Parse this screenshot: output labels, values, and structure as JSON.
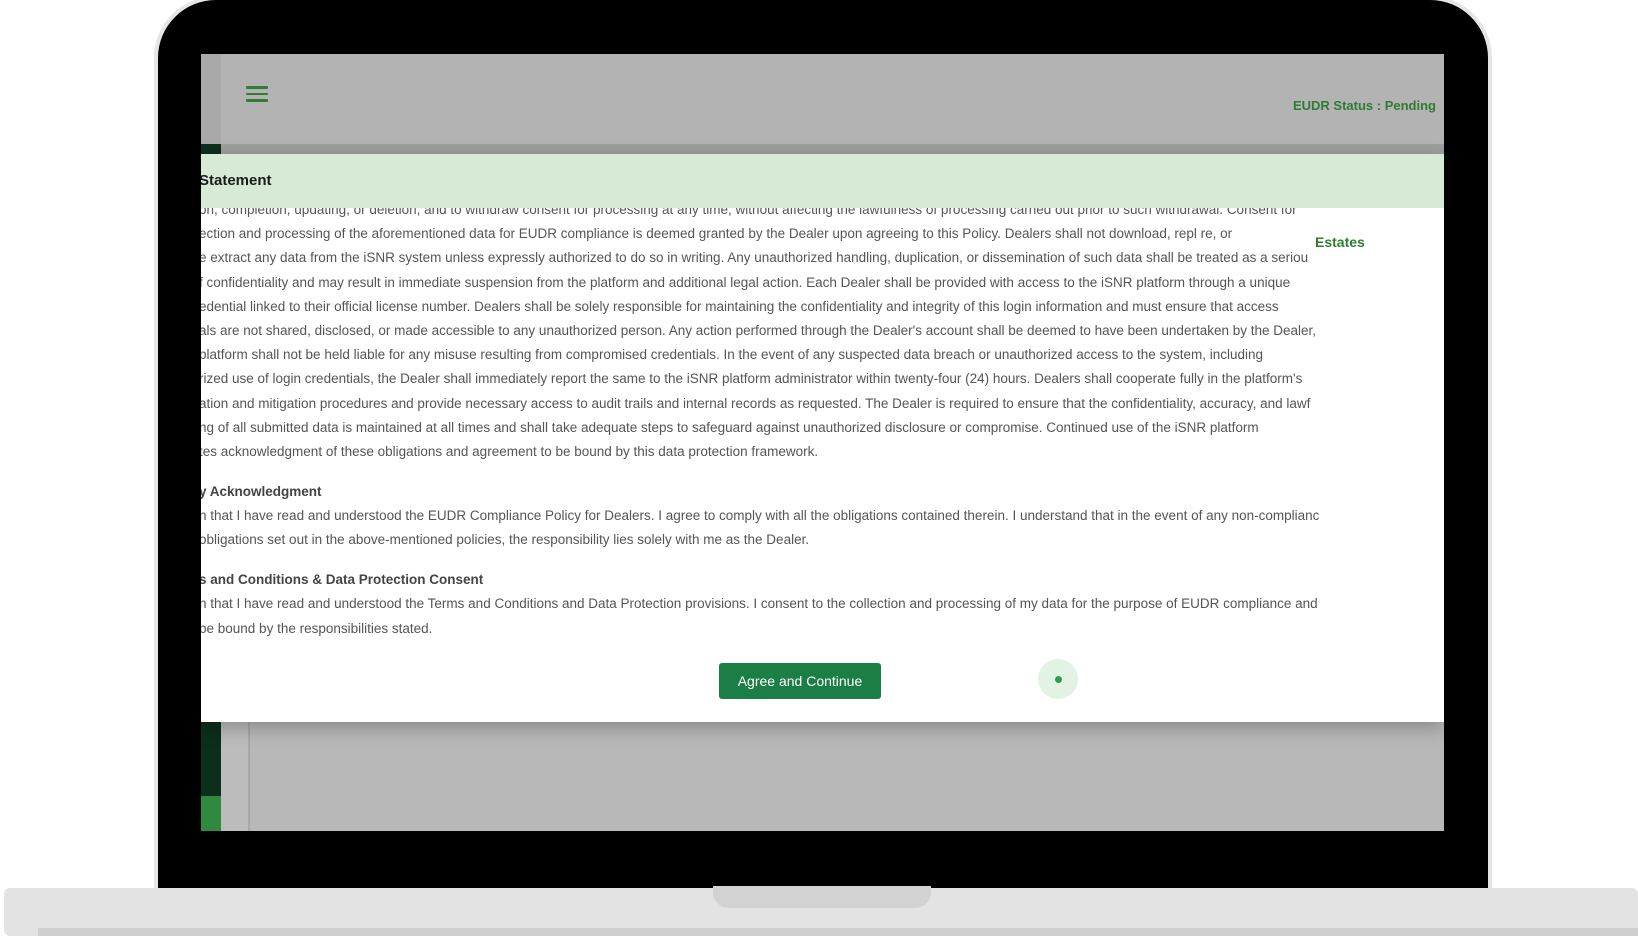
{
  "header": {
    "status_text": "EUDR Status : Pending"
  },
  "modal": {
    "title": "Statement",
    "estates_tag": "Estates",
    "paragraph_lines": [
      "on, completion, updating, or deletion, and to withdraw consent for processing at any time, without affecting the lawfulness of processing carried out prior to such withdrawal. Consent for",
      "ection and processing of the aforementioned data for EUDR compliance is deemed granted by the Dealer upon agreeing to this Policy. Dealers shall not download, repl                     re, or",
      "e extract any data from the iSNR system unless expressly authorized to do so in writing. Any unauthorized handling, duplication, or dissemination of such data shall be treated as a seriou",
      "f confidentiality and may result in immediate suspension from the platform and additional legal action. Each Dealer shall be provided with access to the iSNR platform through a unique",
      "edential linked to their official license number. Dealers shall be solely responsible for maintaining the confidentiality and integrity of this login information and must ensure that access",
      "als are not shared, disclosed, or made accessible to any unauthorized person. Any action performed through the Dealer's account shall be deemed to have been undertaken by the Dealer,",
      "platform shall not be held liable for any misuse resulting from compromised credentials. In the event of any suspected data breach or unauthorized access to the system, including",
      "rized use of login credentials, the Dealer shall immediately report the same to the iSNR platform administrator within twenty-four (24) hours. Dealers shall cooperate fully in the platform's",
      "ation and mitigation procedures and provide necessary access to audit trails and internal records as requested. The Dealer is required to ensure that the confidentiality, accuracy, and lawf",
      "ng of all submitted data is maintained at all times and shall take adequate steps to safeguard against unauthorized disclosure or compromise. Continued use of the iSNR platform",
      "tes acknowledgment of these obligations and agreement to be bound by this data protection framework."
    ],
    "acknowledgment_heading": "y Acknowledgment",
    "acknowledgment_lines": [
      "n that I have read and understood the EUDR Compliance Policy for Dealers. I agree to comply with all the obligations contained therein. I understand that in the event of any non-complianc",
      "obligations set out in the above-mentioned policies, the responsibility lies solely with me as the Dealer."
    ],
    "terms_heading": "s and Conditions & Data Protection Consent",
    "terms_lines": [
      "n that I have read and understood the Terms and Conditions and Data Protection provisions. I consent to the collection and processing of my data for the purpose of EUDR compliance and",
      "be bound by the responsibilities stated."
    ],
    "agree_button_label": "Agree and Continue"
  },
  "colors": {
    "accent_green": "#2e7d32",
    "button_green": "#1b7f45",
    "modal_header_bg": "#d6ead6",
    "sidebar_dark": "#0c2e1c"
  },
  "icons": {
    "menu": "hamburger-menu-icon",
    "loading": "loading-spinner-icon"
  }
}
